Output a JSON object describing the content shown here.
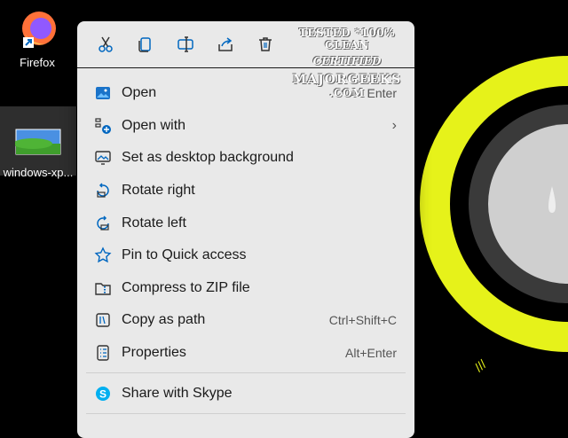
{
  "desktop": {
    "icons": [
      {
        "label": "Firefox"
      },
      {
        "label": "windows-xp..."
      }
    ]
  },
  "context_menu": {
    "toolbar": [
      "cut-icon",
      "copy-icon",
      "rename-icon",
      "share-icon",
      "delete-icon"
    ],
    "items": [
      {
        "label": "Open",
        "shortcut": "Enter",
        "icon": "image-icon"
      },
      {
        "label": "Open with",
        "shortcut": "",
        "icon": "open-with-icon",
        "submenu": "›"
      },
      {
        "label": "Set as desktop background",
        "shortcut": "",
        "icon": "desktop-background-icon"
      },
      {
        "label": "Rotate right",
        "shortcut": "",
        "icon": "rotate-right-icon"
      },
      {
        "label": "Rotate left",
        "shortcut": "",
        "icon": "rotate-left-icon"
      },
      {
        "label": "Pin to Quick access",
        "shortcut": "",
        "icon": "star-icon"
      },
      {
        "label": "Compress to ZIP file",
        "shortcut": "",
        "icon": "zip-icon"
      },
      {
        "label": "Copy as path",
        "shortcut": "Ctrl+Shift+C",
        "icon": "copy-path-icon"
      },
      {
        "label": "Properties",
        "shortcut": "Alt+Enter",
        "icon": "properties-icon"
      },
      {
        "label": "Share with Skype",
        "shortcut": "",
        "icon": "skype-icon"
      }
    ]
  },
  "watermark": {
    "line1": "TESTED *100% CLEAN",
    "line2": "CERTIFIED",
    "line3": "MAJORGEEKS",
    "line4": ".COM"
  },
  "colors": {
    "menu_bg": "#e9e9e9",
    "accent": "#0067c0",
    "wallpaper_ring": "#e6f21a"
  }
}
